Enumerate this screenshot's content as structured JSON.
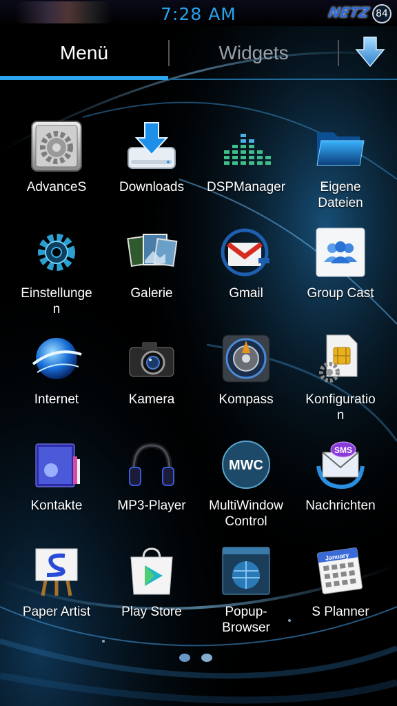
{
  "status_bar": {
    "time": "7:28 AM",
    "logo_text": "NETZ",
    "battery": "84"
  },
  "tabs": {
    "menu_label": "Menü",
    "widgets_label": "Widgets",
    "download_icon": "download-arrow-icon"
  },
  "apps": [
    {
      "label": "AdvanceS",
      "icon": "gear-settings-icon"
    },
    {
      "label": "Downloads",
      "icon": "download-drive-icon"
    },
    {
      "label": "DSPManager",
      "icon": "equalizer-icon"
    },
    {
      "label": "Eigene\nDateien",
      "icon": "folder-icon"
    },
    {
      "label": "Einstellunge\nn",
      "icon": "gear-icon"
    },
    {
      "label": "Galerie",
      "icon": "photo-gallery-icon"
    },
    {
      "label": "Gmail",
      "icon": "gmail-icon"
    },
    {
      "label": "Group Cast",
      "icon": "group-icon"
    },
    {
      "label": "Internet",
      "icon": "globe-icon"
    },
    {
      "label": "Kamera",
      "icon": "camera-icon"
    },
    {
      "label": "Kompass",
      "icon": "compass-icon"
    },
    {
      "label": "Konfiguratio\nn",
      "icon": "sim-config-icon"
    },
    {
      "label": "Kontakte",
      "icon": "contacts-book-icon"
    },
    {
      "label": "MP3-Player",
      "icon": "headphones-icon"
    },
    {
      "label": "MultiWindow\nControl",
      "icon": "mwc-icon"
    },
    {
      "label": "Nachrichten",
      "icon": "sms-envelope-icon"
    },
    {
      "label": "Paper Artist",
      "icon": "easel-icon"
    },
    {
      "label": "Play Store",
      "icon": "play-store-bag-icon"
    },
    {
      "label": "Popup-\nBrowser",
      "icon": "popup-browser-icon"
    },
    {
      "label": "S Planner",
      "icon": "calendar-icon"
    }
  ],
  "mwc_badge": "MWC",
  "sms_badge": "SMS",
  "calendar_month": "January",
  "page_indicator": {
    "pages": 2,
    "current": 1
  },
  "colors": {
    "accent": "#2ba6ef",
    "clock": "#29a3e8",
    "background": "#000000"
  }
}
